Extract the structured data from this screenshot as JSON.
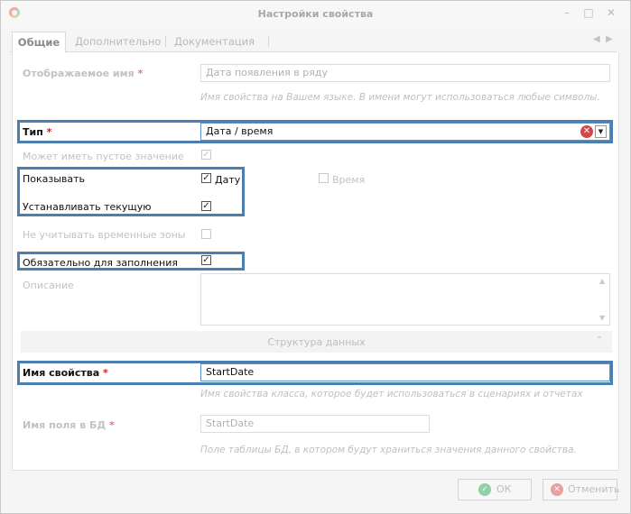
{
  "window": {
    "title": "Настройки свойства"
  },
  "tabs": [
    {
      "label": "Общие"
    },
    {
      "label": "Дополнительно"
    },
    {
      "label": "Документация"
    }
  ],
  "form": {
    "display_name": {
      "label": "Отображаемое имя",
      "required_mark": "*",
      "value": "Дата появления в ряду",
      "hint": "Имя свойства на Вашем языке. В имени могут использоваться любые символы."
    },
    "type": {
      "label": "Тип",
      "required_mark": "*",
      "value": "Дата / время"
    },
    "nullable": {
      "label": "Может иметь пустое значение",
      "checked": true
    },
    "show": {
      "label": "Показывать",
      "date": {
        "label": "Дату",
        "checked": true
      },
      "time": {
        "label": "Время",
        "checked": false
      }
    },
    "set_current": {
      "label": "Устанавливать текущую",
      "checked": true
    },
    "ignore_timezones": {
      "label": "Не учитывать временные зоны",
      "checked": false
    },
    "mandatory": {
      "label": "Обязательно для заполнения",
      "checked": true
    },
    "description": {
      "label": "Описание",
      "value": ""
    },
    "data_structure": {
      "title": "Структура данных"
    },
    "property_name": {
      "label": "Имя свойства",
      "required_mark": "*",
      "value": "StartDate",
      "hint": "Имя свойства класса, которое будет использоваться в сценариях и отчетах"
    },
    "db_field": {
      "label": "Имя поля в БД",
      "required_mark": "*",
      "value": "StartDate",
      "hint": "Поле таблицы БД, в котором будут храниться значения данного свойства."
    }
  },
  "buttons": {
    "ok": "ОК",
    "cancel": "Отменить"
  },
  "colors": {
    "highlight": "#4a7fb0",
    "required_active": "#d02020",
    "ok_icon": "#8fd0a8",
    "cancel_icon": "#e8a0a0"
  }
}
